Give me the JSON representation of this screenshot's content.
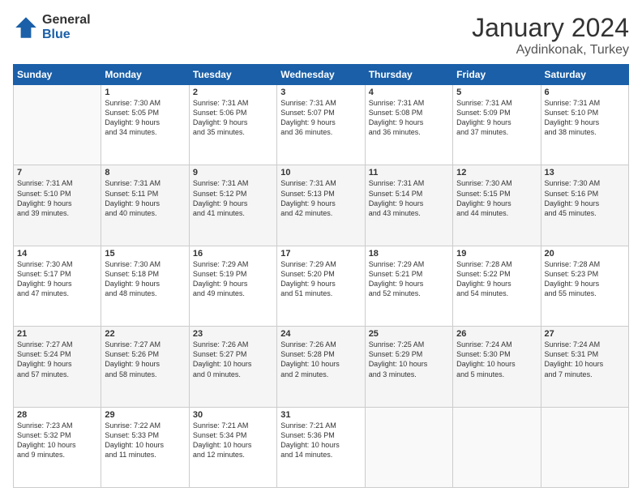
{
  "header": {
    "logo_general": "General",
    "logo_blue": "Blue",
    "month_title": "January 2024",
    "location": "Aydinkonak, Turkey"
  },
  "days_of_week": [
    "Sunday",
    "Monday",
    "Tuesday",
    "Wednesday",
    "Thursday",
    "Friday",
    "Saturday"
  ],
  "weeks": [
    [
      {
        "day": "",
        "info": ""
      },
      {
        "day": "1",
        "info": "Sunrise: 7:30 AM\nSunset: 5:05 PM\nDaylight: 9 hours\nand 34 minutes."
      },
      {
        "day": "2",
        "info": "Sunrise: 7:31 AM\nSunset: 5:06 PM\nDaylight: 9 hours\nand 35 minutes."
      },
      {
        "day": "3",
        "info": "Sunrise: 7:31 AM\nSunset: 5:07 PM\nDaylight: 9 hours\nand 36 minutes."
      },
      {
        "day": "4",
        "info": "Sunrise: 7:31 AM\nSunset: 5:08 PM\nDaylight: 9 hours\nand 36 minutes."
      },
      {
        "day": "5",
        "info": "Sunrise: 7:31 AM\nSunset: 5:09 PM\nDaylight: 9 hours\nand 37 minutes."
      },
      {
        "day": "6",
        "info": "Sunrise: 7:31 AM\nSunset: 5:10 PM\nDaylight: 9 hours\nand 38 minutes."
      }
    ],
    [
      {
        "day": "7",
        "info": "Sunrise: 7:31 AM\nSunset: 5:10 PM\nDaylight: 9 hours\nand 39 minutes."
      },
      {
        "day": "8",
        "info": "Sunrise: 7:31 AM\nSunset: 5:11 PM\nDaylight: 9 hours\nand 40 minutes."
      },
      {
        "day": "9",
        "info": "Sunrise: 7:31 AM\nSunset: 5:12 PM\nDaylight: 9 hours\nand 41 minutes."
      },
      {
        "day": "10",
        "info": "Sunrise: 7:31 AM\nSunset: 5:13 PM\nDaylight: 9 hours\nand 42 minutes."
      },
      {
        "day": "11",
        "info": "Sunrise: 7:31 AM\nSunset: 5:14 PM\nDaylight: 9 hours\nand 43 minutes."
      },
      {
        "day": "12",
        "info": "Sunrise: 7:30 AM\nSunset: 5:15 PM\nDaylight: 9 hours\nand 44 minutes."
      },
      {
        "day": "13",
        "info": "Sunrise: 7:30 AM\nSunset: 5:16 PM\nDaylight: 9 hours\nand 45 minutes."
      }
    ],
    [
      {
        "day": "14",
        "info": "Sunrise: 7:30 AM\nSunset: 5:17 PM\nDaylight: 9 hours\nand 47 minutes."
      },
      {
        "day": "15",
        "info": "Sunrise: 7:30 AM\nSunset: 5:18 PM\nDaylight: 9 hours\nand 48 minutes."
      },
      {
        "day": "16",
        "info": "Sunrise: 7:29 AM\nSunset: 5:19 PM\nDaylight: 9 hours\nand 49 minutes."
      },
      {
        "day": "17",
        "info": "Sunrise: 7:29 AM\nSunset: 5:20 PM\nDaylight: 9 hours\nand 51 minutes."
      },
      {
        "day": "18",
        "info": "Sunrise: 7:29 AM\nSunset: 5:21 PM\nDaylight: 9 hours\nand 52 minutes."
      },
      {
        "day": "19",
        "info": "Sunrise: 7:28 AM\nSunset: 5:22 PM\nDaylight: 9 hours\nand 54 minutes."
      },
      {
        "day": "20",
        "info": "Sunrise: 7:28 AM\nSunset: 5:23 PM\nDaylight: 9 hours\nand 55 minutes."
      }
    ],
    [
      {
        "day": "21",
        "info": "Sunrise: 7:27 AM\nSunset: 5:24 PM\nDaylight: 9 hours\nand 57 minutes."
      },
      {
        "day": "22",
        "info": "Sunrise: 7:27 AM\nSunset: 5:26 PM\nDaylight: 9 hours\nand 58 minutes."
      },
      {
        "day": "23",
        "info": "Sunrise: 7:26 AM\nSunset: 5:27 PM\nDaylight: 10 hours\nand 0 minutes."
      },
      {
        "day": "24",
        "info": "Sunrise: 7:26 AM\nSunset: 5:28 PM\nDaylight: 10 hours\nand 2 minutes."
      },
      {
        "day": "25",
        "info": "Sunrise: 7:25 AM\nSunset: 5:29 PM\nDaylight: 10 hours\nand 3 minutes."
      },
      {
        "day": "26",
        "info": "Sunrise: 7:24 AM\nSunset: 5:30 PM\nDaylight: 10 hours\nand 5 minutes."
      },
      {
        "day": "27",
        "info": "Sunrise: 7:24 AM\nSunset: 5:31 PM\nDaylight: 10 hours\nand 7 minutes."
      }
    ],
    [
      {
        "day": "28",
        "info": "Sunrise: 7:23 AM\nSunset: 5:32 PM\nDaylight: 10 hours\nand 9 minutes."
      },
      {
        "day": "29",
        "info": "Sunrise: 7:22 AM\nSunset: 5:33 PM\nDaylight: 10 hours\nand 11 minutes."
      },
      {
        "day": "30",
        "info": "Sunrise: 7:21 AM\nSunset: 5:34 PM\nDaylight: 10 hours\nand 12 minutes."
      },
      {
        "day": "31",
        "info": "Sunrise: 7:21 AM\nSunset: 5:36 PM\nDaylight: 10 hours\nand 14 minutes."
      },
      {
        "day": "",
        "info": ""
      },
      {
        "day": "",
        "info": ""
      },
      {
        "day": "",
        "info": ""
      }
    ]
  ]
}
